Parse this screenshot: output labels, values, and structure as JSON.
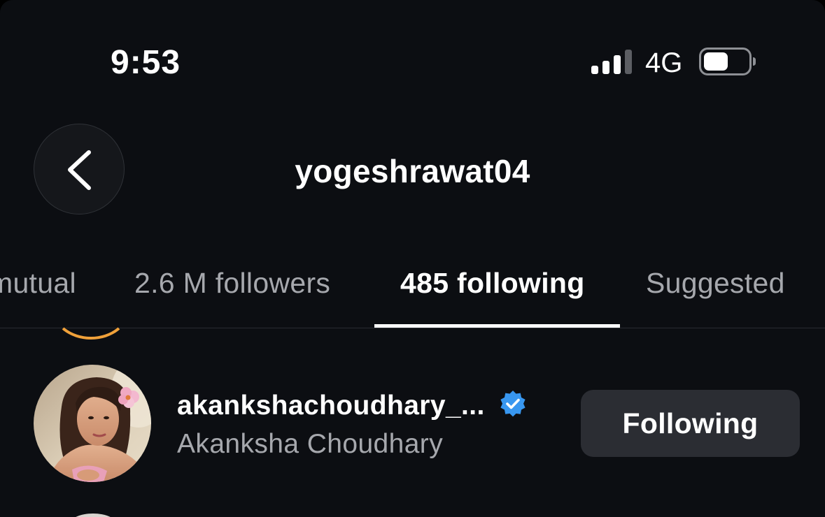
{
  "status_bar": {
    "time": "9:53",
    "network": "4G",
    "signal_bars_active": 3,
    "signal_bars_total": 4,
    "battery_level": 0.55
  },
  "header": {
    "title": "yogeshrawat04",
    "back_icon": "chevron-left-icon"
  },
  "tabs": [
    {
      "label": "mutual",
      "active": false
    },
    {
      "label": "2.6 M followers",
      "active": false
    },
    {
      "label": "485 following",
      "active": true
    },
    {
      "label": "Suggested",
      "active": false
    }
  ],
  "list": {
    "items": [
      {
        "username": "akankshachoudhary_...",
        "full_name": "Akanksha Choudhary",
        "verified": true,
        "button_label": "Following"
      }
    ]
  },
  "colors": {
    "background": "#0c0e12",
    "text_primary": "#ffffff",
    "text_secondary": "#a6a8ad",
    "button_bg": "#2b2d33",
    "verified_blue": "#3897f0",
    "story_ring": "#f0a13a"
  }
}
